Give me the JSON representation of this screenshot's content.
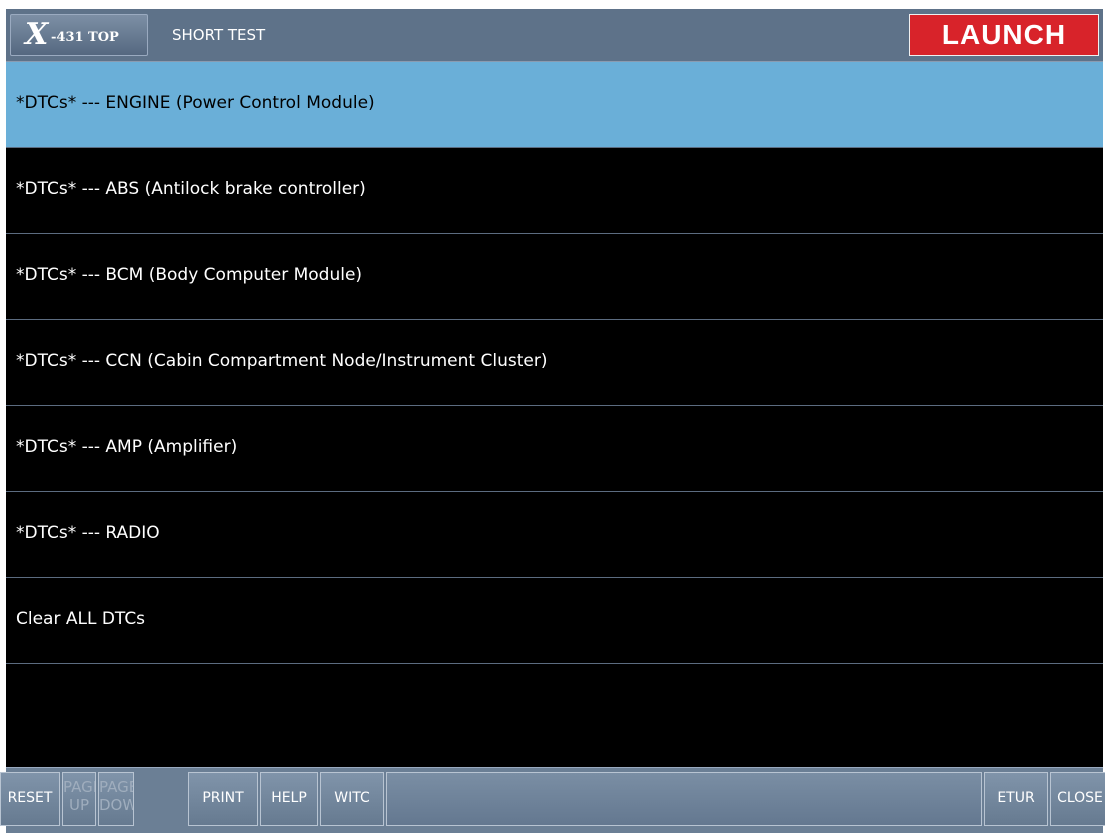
{
  "app": {
    "logo_x": "X",
    "logo_text": "-431 TOP",
    "title": "SHORT TEST",
    "brand": "LAUNCH"
  },
  "list": {
    "items": [
      {
        "label": "*DTCs* --- ENGINE (Power Control Module)",
        "selected": true
      },
      {
        "label": "*DTCs* --- ABS (Antilock brake controller)",
        "selected": false
      },
      {
        "label": "*DTCs* --- BCM (Body Computer Module)",
        "selected": false
      },
      {
        "label": "*DTCs* --- CCN (Cabin Compartment Node/Instrument Cluster)",
        "selected": false
      },
      {
        "label": "*DTCs* --- AMP (Amplifier)",
        "selected": false
      },
      {
        "label": "*DTCs* --- RADIO",
        "selected": false
      },
      {
        "label": "Clear ALL DTCs",
        "selected": false
      }
    ]
  },
  "toolbar": {
    "reset": "RESET",
    "page_up_1": "PAGE",
    "page_up_2": "UP",
    "page_down_1": "PAGE",
    "page_down_2": "DOWN",
    "print": "PRINT",
    "help": "HELP",
    "switch": "WITC",
    "return": "ETUR",
    "close": "CLOSE"
  },
  "colors": {
    "header": "#5e7289",
    "selected_row": "#6aafd8",
    "brand_red": "#d8232a",
    "background": "#000000"
  }
}
